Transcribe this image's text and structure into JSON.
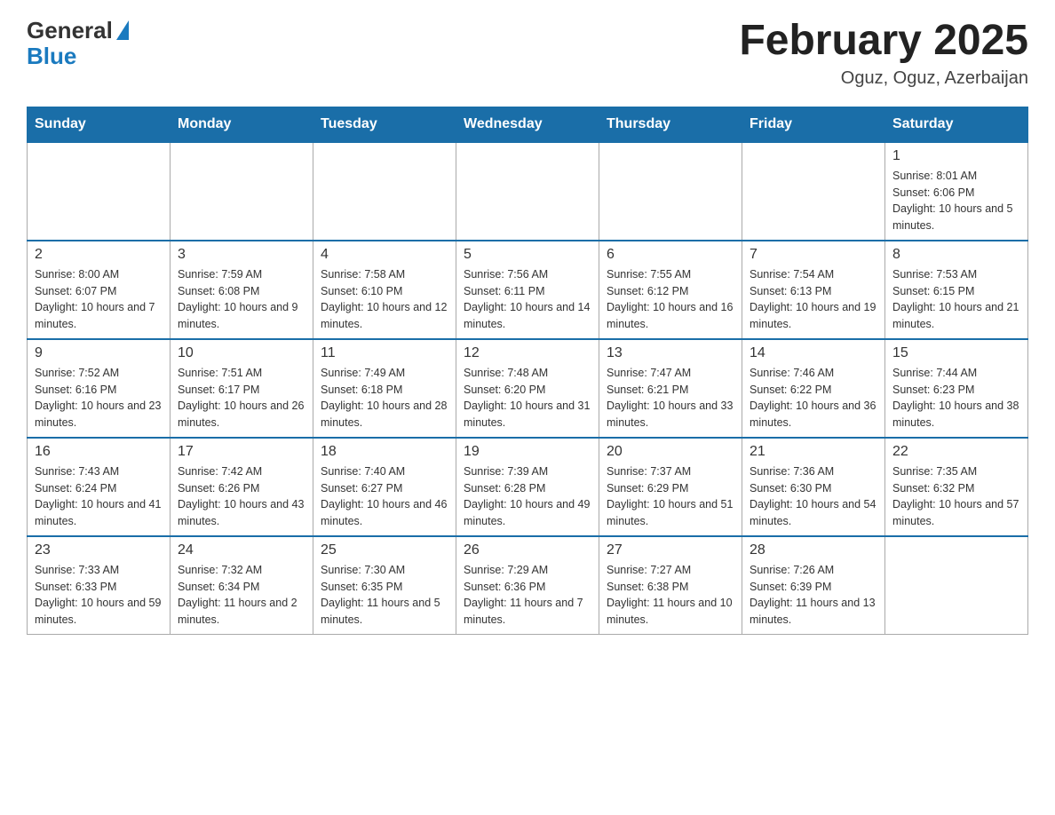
{
  "logo": {
    "general": "General",
    "blue": "Blue"
  },
  "title": "February 2025",
  "location": "Oguz, Oguz, Azerbaijan",
  "days_of_week": [
    "Sunday",
    "Monday",
    "Tuesday",
    "Wednesday",
    "Thursday",
    "Friday",
    "Saturday"
  ],
  "weeks": [
    [
      {
        "day": "",
        "info": ""
      },
      {
        "day": "",
        "info": ""
      },
      {
        "day": "",
        "info": ""
      },
      {
        "day": "",
        "info": ""
      },
      {
        "day": "",
        "info": ""
      },
      {
        "day": "",
        "info": ""
      },
      {
        "day": "1",
        "info": "Sunrise: 8:01 AM\nSunset: 6:06 PM\nDaylight: 10 hours and 5 minutes."
      }
    ],
    [
      {
        "day": "2",
        "info": "Sunrise: 8:00 AM\nSunset: 6:07 PM\nDaylight: 10 hours and 7 minutes."
      },
      {
        "day": "3",
        "info": "Sunrise: 7:59 AM\nSunset: 6:08 PM\nDaylight: 10 hours and 9 minutes."
      },
      {
        "day": "4",
        "info": "Sunrise: 7:58 AM\nSunset: 6:10 PM\nDaylight: 10 hours and 12 minutes."
      },
      {
        "day": "5",
        "info": "Sunrise: 7:56 AM\nSunset: 6:11 PM\nDaylight: 10 hours and 14 minutes."
      },
      {
        "day": "6",
        "info": "Sunrise: 7:55 AM\nSunset: 6:12 PM\nDaylight: 10 hours and 16 minutes."
      },
      {
        "day": "7",
        "info": "Sunrise: 7:54 AM\nSunset: 6:13 PM\nDaylight: 10 hours and 19 minutes."
      },
      {
        "day": "8",
        "info": "Sunrise: 7:53 AM\nSunset: 6:15 PM\nDaylight: 10 hours and 21 minutes."
      }
    ],
    [
      {
        "day": "9",
        "info": "Sunrise: 7:52 AM\nSunset: 6:16 PM\nDaylight: 10 hours and 23 minutes."
      },
      {
        "day": "10",
        "info": "Sunrise: 7:51 AM\nSunset: 6:17 PM\nDaylight: 10 hours and 26 minutes."
      },
      {
        "day": "11",
        "info": "Sunrise: 7:49 AM\nSunset: 6:18 PM\nDaylight: 10 hours and 28 minutes."
      },
      {
        "day": "12",
        "info": "Sunrise: 7:48 AM\nSunset: 6:20 PM\nDaylight: 10 hours and 31 minutes."
      },
      {
        "day": "13",
        "info": "Sunrise: 7:47 AM\nSunset: 6:21 PM\nDaylight: 10 hours and 33 minutes."
      },
      {
        "day": "14",
        "info": "Sunrise: 7:46 AM\nSunset: 6:22 PM\nDaylight: 10 hours and 36 minutes."
      },
      {
        "day": "15",
        "info": "Sunrise: 7:44 AM\nSunset: 6:23 PM\nDaylight: 10 hours and 38 minutes."
      }
    ],
    [
      {
        "day": "16",
        "info": "Sunrise: 7:43 AM\nSunset: 6:24 PM\nDaylight: 10 hours and 41 minutes."
      },
      {
        "day": "17",
        "info": "Sunrise: 7:42 AM\nSunset: 6:26 PM\nDaylight: 10 hours and 43 minutes."
      },
      {
        "day": "18",
        "info": "Sunrise: 7:40 AM\nSunset: 6:27 PM\nDaylight: 10 hours and 46 minutes."
      },
      {
        "day": "19",
        "info": "Sunrise: 7:39 AM\nSunset: 6:28 PM\nDaylight: 10 hours and 49 minutes."
      },
      {
        "day": "20",
        "info": "Sunrise: 7:37 AM\nSunset: 6:29 PM\nDaylight: 10 hours and 51 minutes."
      },
      {
        "day": "21",
        "info": "Sunrise: 7:36 AM\nSunset: 6:30 PM\nDaylight: 10 hours and 54 minutes."
      },
      {
        "day": "22",
        "info": "Sunrise: 7:35 AM\nSunset: 6:32 PM\nDaylight: 10 hours and 57 minutes."
      }
    ],
    [
      {
        "day": "23",
        "info": "Sunrise: 7:33 AM\nSunset: 6:33 PM\nDaylight: 10 hours and 59 minutes."
      },
      {
        "day": "24",
        "info": "Sunrise: 7:32 AM\nSunset: 6:34 PM\nDaylight: 11 hours and 2 minutes."
      },
      {
        "day": "25",
        "info": "Sunrise: 7:30 AM\nSunset: 6:35 PM\nDaylight: 11 hours and 5 minutes."
      },
      {
        "day": "26",
        "info": "Sunrise: 7:29 AM\nSunset: 6:36 PM\nDaylight: 11 hours and 7 minutes."
      },
      {
        "day": "27",
        "info": "Sunrise: 7:27 AM\nSunset: 6:38 PM\nDaylight: 11 hours and 10 minutes."
      },
      {
        "day": "28",
        "info": "Sunrise: 7:26 AM\nSunset: 6:39 PM\nDaylight: 11 hours and 13 minutes."
      },
      {
        "day": "",
        "info": ""
      }
    ]
  ]
}
